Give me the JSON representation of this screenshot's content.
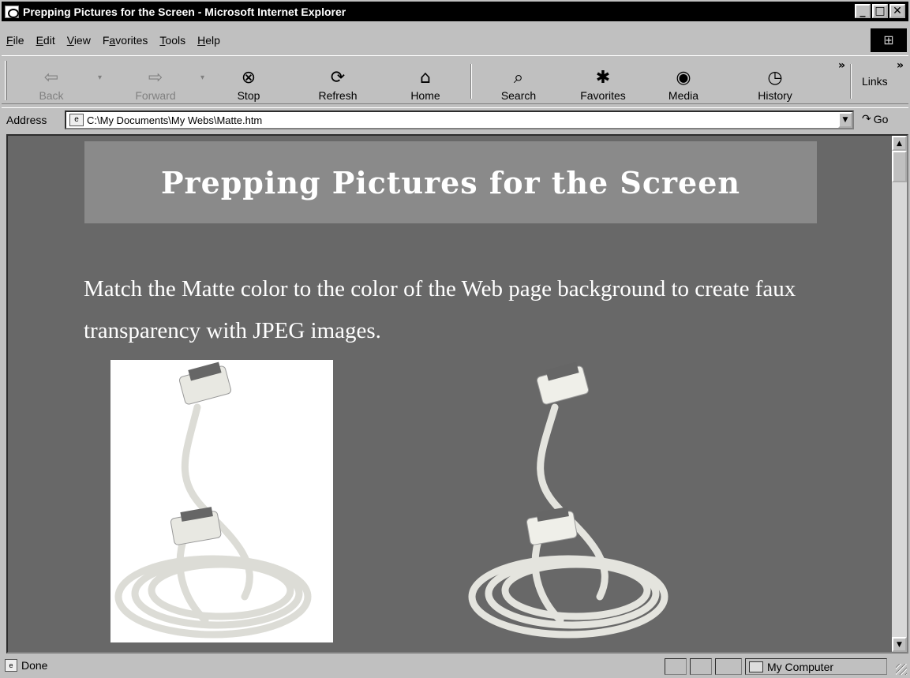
{
  "window": {
    "title": "Prepping Pictures for the Screen - Microsoft Internet Explorer",
    "controls": {
      "minimize": "_",
      "maximize": "□",
      "close": "✕"
    }
  },
  "menu": [
    {
      "pre": "",
      "key": "F",
      "post": "ile"
    },
    {
      "pre": "",
      "key": "E",
      "post": "dit"
    },
    {
      "pre": "",
      "key": "V",
      "post": "iew"
    },
    {
      "pre": "F",
      "key": "a",
      "post": "vorites"
    },
    {
      "pre": "",
      "key": "T",
      "post": "ools"
    },
    {
      "pre": "",
      "key": "H",
      "post": "elp"
    }
  ],
  "toolbar": {
    "back": {
      "label": "Back",
      "icon": "⇦"
    },
    "forward": {
      "label": "Forward",
      "icon": "⇨"
    },
    "stop": {
      "label": "Stop",
      "icon": "⊗"
    },
    "refresh": {
      "label": "Refresh",
      "icon": "⟳"
    },
    "home": {
      "label": "Home",
      "icon": "⌂"
    },
    "search": {
      "label": "Search",
      "icon": "⌕"
    },
    "favorites": {
      "label": "Favorites",
      "icon": "✱"
    },
    "media": {
      "label": "Media",
      "icon": "◉"
    },
    "history": {
      "label": "History",
      "icon": "◷"
    },
    "links": "Links",
    "chevron": "»",
    "dropdown": "▾"
  },
  "address": {
    "label": "Address",
    "url": "C:\\My Documents\\My Webs\\Matte.htm",
    "go_label": "Go",
    "dropdown": "▼"
  },
  "page": {
    "heading": "Prepping Pictures for the Screen",
    "body": "Match the Matte color to the color of the Web page background to create faux transparency with JPEG images.",
    "background": "#686868",
    "banner_color": "#8a8a8a"
  },
  "status": {
    "text": "Done",
    "zone": "My Computer"
  }
}
